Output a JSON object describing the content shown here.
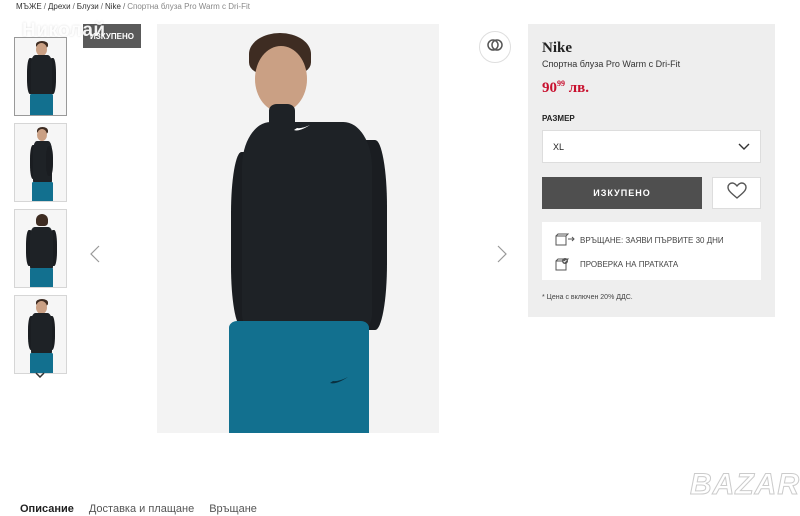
{
  "breadcrumb": {
    "items": [
      "МЪЖЕ",
      "Дрехи",
      "Блузи",
      "Nike"
    ],
    "current": "Спортна блуза Pro Warm с Dri-Fit",
    "separator": "/"
  },
  "watermark": "Николай",
  "sold_badge": "ИЗКУПЕНО",
  "gallery": {
    "thumbnails": [
      "thumbnail-front",
      "thumbnail-side",
      "thumbnail-back",
      "thumbnail-pose"
    ],
    "active_index": 0
  },
  "product": {
    "brand": "Nike",
    "name": "Спортна блуза Pro Warm с Dri-Fit",
    "price_main": "90",
    "price_cents": "99",
    "currency": "лв.",
    "size_label": "РАЗМЕР",
    "selected_size": "XL",
    "sold_out_label": "ИЗКУПЕНО",
    "returns_text": "ВРЪЩАНЕ: ЗАЯВИ ПЪРВИТЕ 30 ДНИ",
    "check_text": "ПРОВЕРКА НА ПРАТКАТА",
    "vat_note": "* Цена с включен 20% ДДС."
  },
  "tabs": [
    {
      "label": "Описание",
      "active": true
    },
    {
      "label": "Доставка и плащане",
      "active": false
    },
    {
      "label": "Връщане",
      "active": false
    }
  ],
  "logo_text": "BAZAR",
  "colors": {
    "price": "#c8102e",
    "sold_out_button": "#4f4f4f",
    "panel_background": "#eeeeee",
    "shirt": "#1e2226",
    "pants": "#12708f"
  },
  "icons": {
    "compare": "compare-rings-icon",
    "wishlist": "heart-icon",
    "returns": "returns-box-icon",
    "check": "package-check-icon",
    "prev": "chevron-left-icon",
    "next": "chevron-right-icon",
    "thumbs_down": "chevron-down-icon",
    "select": "chevron-down-icon"
  }
}
